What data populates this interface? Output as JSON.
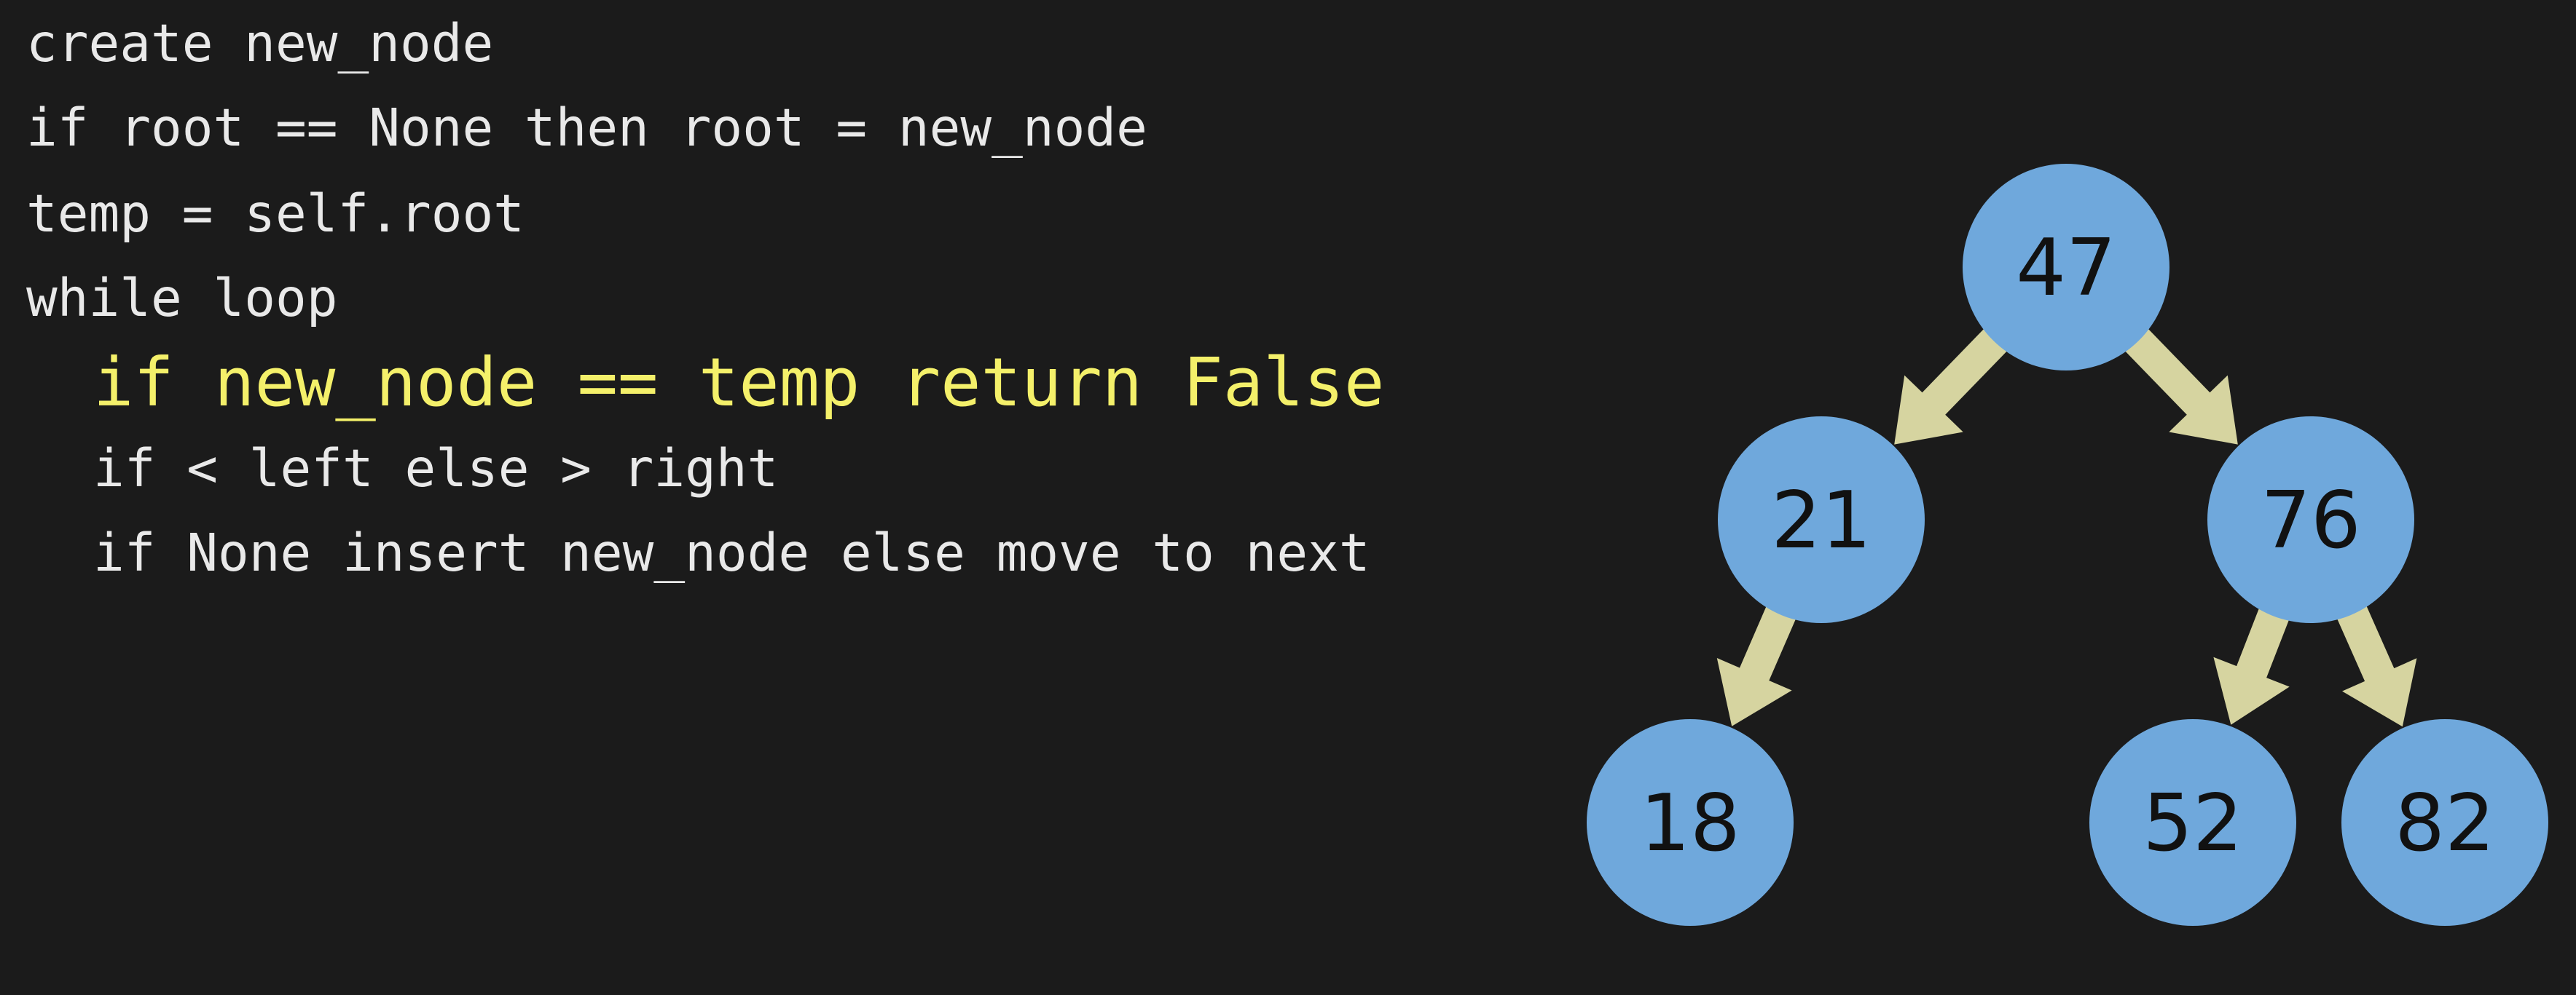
{
  "pseudocode": {
    "lines": [
      "create new_node",
      "if root == None then root = new_node",
      "temp = self.root",
      "while loop",
      "if new_node == temp return False",
      "if < left else > right",
      "if None insert new_node else move to next"
    ],
    "highlighted_line_index": 4,
    "highlight_color": "#f4f06a",
    "text_color": "#e9e9e9"
  },
  "tree": {
    "nodes": [
      {
        "id": "n47",
        "label": "47"
      },
      {
        "id": "n21",
        "label": "21"
      },
      {
        "id": "n76",
        "label": "76"
      },
      {
        "id": "n18",
        "label": "18"
      },
      {
        "id": "n52",
        "label": "52"
      },
      {
        "id": "n82",
        "label": "82"
      }
    ],
    "edges": [
      {
        "from": "n47",
        "to": "n21"
      },
      {
        "from": "n47",
        "to": "n76"
      },
      {
        "from": "n21",
        "to": "n18"
      },
      {
        "from": "n76",
        "to": "n52"
      },
      {
        "from": "n76",
        "to": "n82"
      }
    ],
    "node_color": "#6fa8dc",
    "arrow_color": "#d6d4a0"
  }
}
